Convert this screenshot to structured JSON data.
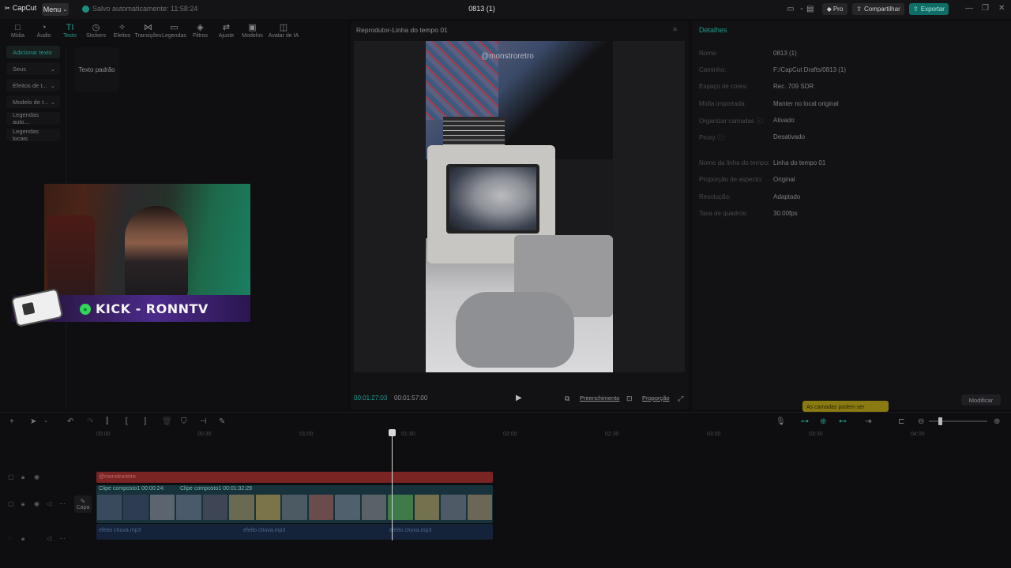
{
  "app": {
    "logo_text": "CapCut",
    "menu_label": "Menu",
    "autosave_text": "Salvo automaticamente: 11:58:24",
    "project_title": "0813 (1)"
  },
  "titlebar": {
    "pro_label": "Pro",
    "share_label": "Compartilhar",
    "export_label": "Exportar",
    "accent_color": "#0f6d67"
  },
  "tools": [
    {
      "label": "Mídia",
      "icon": "□"
    },
    {
      "label": "Áudio",
      "icon": "◔"
    },
    {
      "label": "Texto",
      "icon": "TI"
    },
    {
      "label": "Stickers",
      "icon": "◷"
    },
    {
      "label": "Efeitos",
      "icon": "✧"
    },
    {
      "label": "Transições",
      "icon": "⋈"
    },
    {
      "label": "Legendas",
      "icon": "▭"
    },
    {
      "label": "Filtros",
      "icon": "◈"
    },
    {
      "label": "Ajuste",
      "icon": "⇄"
    },
    {
      "label": "Modelos",
      "icon": "▣"
    },
    {
      "label": "Avatar de IA",
      "icon": "◫"
    }
  ],
  "text_sidebar": [
    {
      "label": "Adicionar texto",
      "chevron": ""
    },
    {
      "label": "Seus",
      "chevron": "⌄"
    },
    {
      "label": "Efeitos de t...",
      "chevron": "⌄"
    },
    {
      "label": "Modelo de t...",
      "chevron": "⌄"
    },
    {
      "label": "Legendas auto...",
      "chevron": ""
    },
    {
      "label": "Legendas locais",
      "chevron": ""
    }
  ],
  "preset_card": "Texto padrão",
  "overlay": {
    "banner_text": "KICK - RONNTV"
  },
  "player": {
    "title": "Reprodutor-Linha do tempo 01",
    "watermark": "@monstroretro",
    "current_time": "00:01:27:03",
    "total_time": "00:01:57:00",
    "fill_label": "Preenchimento",
    "ratio_label": "Proporção"
  },
  "details": {
    "title": "Detalhes",
    "rows": [
      {
        "key": "Nome:",
        "value": "0813 (1)"
      },
      {
        "key": "Caminho:",
        "value": "F:/CapCut Drafts/0813 (1)"
      },
      {
        "key": "Espaço de cores:",
        "value": "Rec. 709 SDR"
      },
      {
        "key": "Mídia importada:",
        "value": "Manter no local original"
      },
      {
        "key": "Organizar camadas ⓘ:",
        "value": "Ativado"
      },
      {
        "key": "Proxy ⓘ:",
        "value": "Desativado"
      },
      {
        "key": "Nome da linha do tempo:",
        "value": "Linha do tempo 01"
      },
      {
        "key": "Proporção de aspecto:",
        "value": "Original"
      },
      {
        "key": "Resolução:",
        "value": "Adaptado"
      },
      {
        "key": "Taxa de quadros:",
        "value": "30.00fps"
      }
    ],
    "modify_label": "Modificar",
    "tooltip": "As camadas podem ser"
  },
  "timeline": {
    "ticks": [
      "00:00",
      "00:30",
      "01:00",
      "01:30",
      "02:00",
      "02:30",
      "03:00",
      "03:30",
      "04:00"
    ],
    "text_clip": "@monstroretro",
    "clips": [
      "Clipe composto1  00:00:24:",
      "Clipe composto1  00:01:32:29"
    ],
    "cover_label": "Capa",
    "audio_clips": [
      "efeito chuva.mp3",
      "efeito chuva.mp3",
      "efeito chuva.mp3"
    ]
  }
}
